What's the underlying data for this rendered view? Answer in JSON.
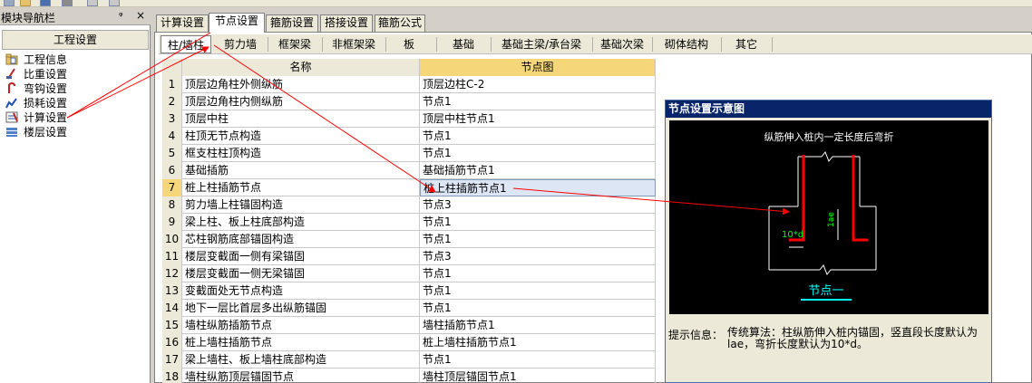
{
  "nav": {
    "title": "模块导航栏",
    "pin": "ņ",
    "close": "×",
    "header": "工程设置",
    "items": [
      {
        "label": "工程信息",
        "icon": "folder-info-icon"
      },
      {
        "label": "比重设置",
        "icon": "weight-scale-icon"
      },
      {
        "label": "弯钩设置",
        "icon": "hook-icon"
      },
      {
        "label": "损耗设置",
        "icon": "loss-chart-icon"
      },
      {
        "label": "计算设置",
        "icon": "calc-settings-icon"
      },
      {
        "label": "楼层设置",
        "icon": "floors-icon"
      }
    ]
  },
  "tabs": [
    "计算设置",
    "节点设置",
    "箍筋设置",
    "搭接设置",
    "箍筋公式"
  ],
  "active_tab": 1,
  "subtabs": [
    "柱/墙柱",
    "剪力墙",
    "框架梁",
    "非框架梁",
    "板",
    "基础",
    "基础主梁/承台梁",
    "基础次梁",
    "砌体结构",
    "其它"
  ],
  "active_subtab": 0,
  "grid": {
    "headers": {
      "name": "名称",
      "node": "节点图"
    },
    "selected_row": 7,
    "rows": [
      {
        "num": "1",
        "name": "顶层边角柱外侧纵筋",
        "node": "顶层边柱C-2"
      },
      {
        "num": "2",
        "name": "顶层边角柱内侧纵筋",
        "node": "节点1"
      },
      {
        "num": "3",
        "name": "顶层中柱",
        "node": "顶层中柱节点1"
      },
      {
        "num": "4",
        "name": "柱顶无节点构造",
        "node": "节点1"
      },
      {
        "num": "5",
        "name": "框支柱柱顶构造",
        "node": "节点1"
      },
      {
        "num": "6",
        "name": "基础插筋",
        "node": "基础插筋节点1"
      },
      {
        "num": "7",
        "name": "桩上柱插筋节点",
        "node": "桩上柱插筋节点1"
      },
      {
        "num": "8",
        "name": "剪力墙上柱锚固构造",
        "node": "节点3"
      },
      {
        "num": "9",
        "name": "梁上柱、板上柱底部构造",
        "node": "节点1"
      },
      {
        "num": "10",
        "name": "芯柱钢筋底部锚固构造",
        "node": "节点1"
      },
      {
        "num": "11",
        "name": "楼层变截面一侧有梁锚固",
        "node": "节点3"
      },
      {
        "num": "12",
        "name": "楼层变截面一侧无梁锚固",
        "node": "节点1"
      },
      {
        "num": "13",
        "name": "变截面处无节点构造",
        "node": "节点1"
      },
      {
        "num": "14",
        "name": "地下一层比首层多出纵筋锚固",
        "node": "节点1"
      },
      {
        "num": "15",
        "name": "墙柱纵筋插筋节点",
        "node": "墙柱插筋节点1"
      },
      {
        "num": "16",
        "name": "桩上墙柱插筋节点",
        "node": "桩上墙柱插筋节点1"
      },
      {
        "num": "17",
        "name": "梁上墙柱、板上墙柱底部构造",
        "node": "节点1"
      },
      {
        "num": "18",
        "name": "墙柱纵筋顶层锚固节点",
        "node": "墙柱顶层锚固节点1"
      }
    ]
  },
  "preview": {
    "title": "节点设置示意图",
    "diagram_caption": "纵筋伸入桩内一定长度后弯折",
    "dim_bend": "10*d",
    "dim_anchor": "1ae",
    "node_label": "节点一",
    "info_label": "提示信息：",
    "info_text": "传统算法：柱纵筋伸入桩内锚固，竖直段长度默认为lae，弯折长度默认为10*d。"
  },
  "colors": {
    "annotation": "#ff0000",
    "selection": "#f5d77a",
    "rebar": "#ff0000",
    "dim_text": "#00ff00",
    "node_label": "#00ffff"
  }
}
